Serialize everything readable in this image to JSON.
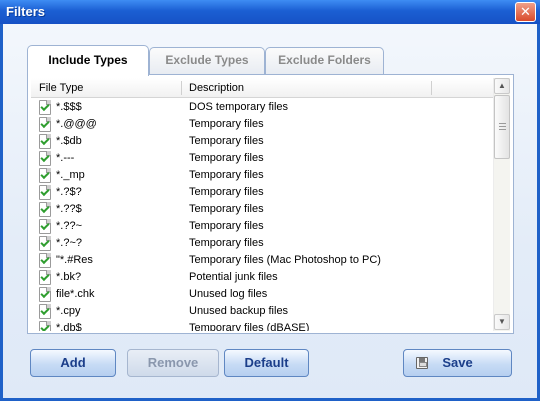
{
  "window": {
    "title": "Filters",
    "close_glyph": "✕"
  },
  "tabs": [
    {
      "label": "Include Types",
      "active": true
    },
    {
      "label": "Exclude Types",
      "active": false
    },
    {
      "label": "Exclude Folders",
      "active": false
    }
  ],
  "list": {
    "columns": {
      "file_type": "File Type",
      "description": "Description"
    },
    "rows": [
      {
        "type": "*.$$$",
        "desc": "DOS temporary files"
      },
      {
        "type": "*.@@@",
        "desc": "Temporary files"
      },
      {
        "type": "*.$db",
        "desc": "Temporary files"
      },
      {
        "type": "*.---",
        "desc": "Temporary files"
      },
      {
        "type": "*._mp",
        "desc": "Temporary files"
      },
      {
        "type": "*.?$?",
        "desc": "Temporary files"
      },
      {
        "type": "*.??$",
        "desc": "Temporary files"
      },
      {
        "type": "*.??~",
        "desc": "Temporary files"
      },
      {
        "type": "*.?~?",
        "desc": "Temporary files"
      },
      {
        "type": "\"*.#Res",
        "desc": "Temporary files (Mac Photoshop to PC)"
      },
      {
        "type": "*.bk?",
        "desc": "Potential junk files"
      },
      {
        "type": "file*.chk",
        "desc": "Unused log files"
      },
      {
        "type": "*.cpy",
        "desc": "Unused backup files"
      },
      {
        "type": "*.db$",
        "desc": "Temporary files (dBASE)"
      }
    ]
  },
  "buttons": {
    "add": "Add",
    "remove": "Remove",
    "default": "Default",
    "save": "Save"
  },
  "icons": {
    "row_icon": "file-checked-icon",
    "save_icon": "floppy-disk-icon"
  },
  "colors": {
    "titlebar": "#1b5fd3",
    "button_text": "#1b3e8a"
  }
}
